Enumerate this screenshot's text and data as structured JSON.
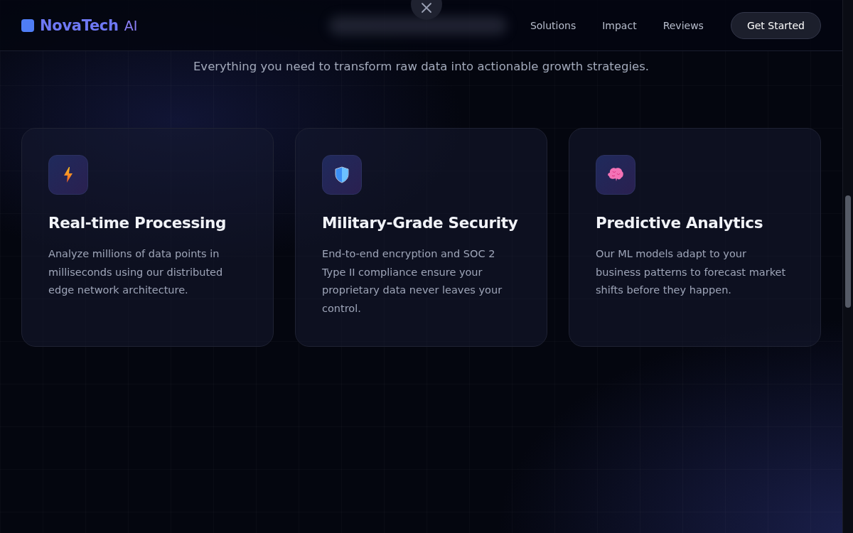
{
  "header": {
    "logo": {
      "name": "NovaTech",
      "suffix": "AI"
    },
    "nav": [
      {
        "label": "Solutions"
      },
      {
        "label": "Impact"
      },
      {
        "label": "Reviews"
      }
    ],
    "cta": "Get Started"
  },
  "subtitle": "Everything you need to transform raw data into actionable growth strategies.",
  "features": [
    {
      "kind": "bolt",
      "title": "Real-time Processing",
      "description": "Analyze millions of data points in milliseconds using our distributed edge network architecture."
    },
    {
      "kind": "shield",
      "title": "Military-Grade Security",
      "description": "End-to-end encryption and SOC 2 Type II compliance ensure your proprietary data never leaves your control."
    },
    {
      "kind": "brain",
      "title": "Predictive Analytics",
      "description": "Our ML models adapt to your business patterns to forecast market shifts before they happen."
    }
  ]
}
